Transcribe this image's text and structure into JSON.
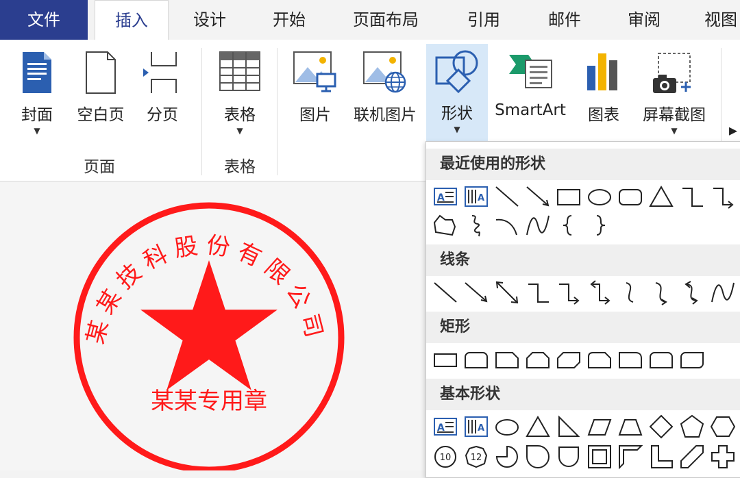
{
  "tabs": [
    {
      "label": "文件"
    },
    {
      "label": "插入"
    },
    {
      "label": "设计"
    },
    {
      "label": "开始"
    },
    {
      "label": "页面布局"
    },
    {
      "label": "引用"
    },
    {
      "label": "邮件"
    },
    {
      "label": "审阅"
    },
    {
      "label": "视图"
    }
  ],
  "ribbon": {
    "page_group": {
      "label": "页面",
      "buttons": [
        {
          "label": "封面"
        },
        {
          "label": "空白页"
        },
        {
          "label": "分页"
        }
      ]
    },
    "table_group": {
      "label": "表格",
      "buttons": [
        {
          "label": "表格"
        }
      ]
    },
    "illus": {
      "buttons": [
        {
          "label": "图片"
        },
        {
          "label": "联机图片"
        },
        {
          "label": "形状"
        },
        {
          "label": "SmartArt"
        },
        {
          "label": "图表"
        },
        {
          "label": "屏幕截图"
        }
      ]
    }
  },
  "stamp": {
    "company": "某某技科股份有限公司",
    "bottom": "某某专用章",
    "color": "#ff1a1a"
  },
  "shapes_panel": {
    "sections": [
      {
        "title": "最近使用的形状"
      },
      {
        "title": "线条"
      },
      {
        "title": "矩形"
      },
      {
        "title": "基本形状"
      }
    ]
  },
  "colors": {
    "file_tab": "#2b3e8f",
    "selected": "#d7e8f8",
    "accent": "#2b5fb0"
  }
}
